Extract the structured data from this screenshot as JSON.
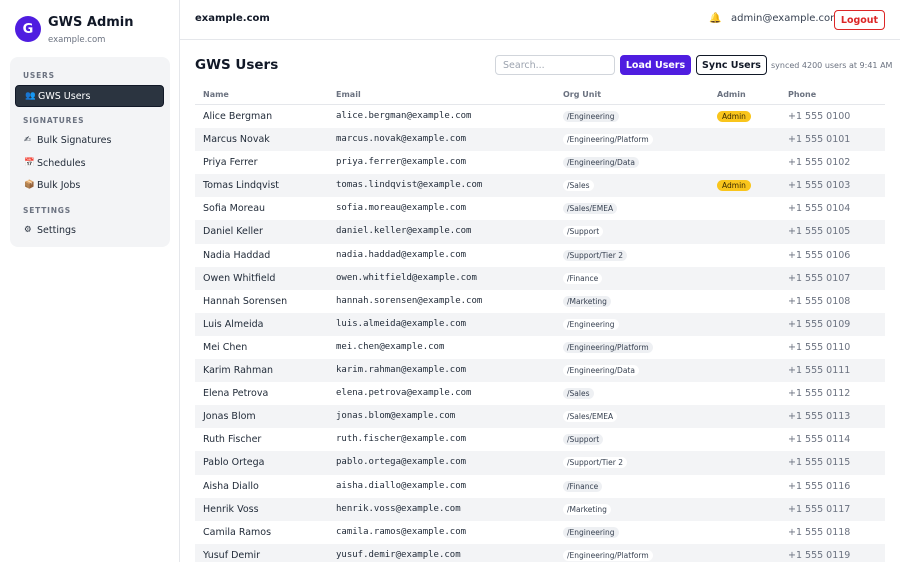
{
  "brand": {
    "logo_letter": "G",
    "title": "GWS Admin",
    "subtitle": "example.com"
  },
  "sidebar": {
    "sections": [
      {
        "label": "USERS"
      },
      {
        "label": "SIGNATURES"
      },
      {
        "label": "SETTINGS"
      }
    ],
    "items": [
      {
        "label": "GWS Users",
        "icon": "users-icon",
        "glyph": "👥",
        "active": true
      },
      {
        "label": "Bulk Signatures",
        "icon": "pen-icon",
        "glyph": "✍"
      },
      {
        "label": "Schedules",
        "icon": "calendar-icon",
        "glyph": "📅"
      },
      {
        "label": "Bulk Jobs",
        "icon": "box-icon",
        "glyph": "📦"
      },
      {
        "label": "Settings",
        "icon": "gear-icon",
        "glyph": "⚙"
      }
    ]
  },
  "topbar": {
    "domain": "example.com",
    "notification_glyph": "🔔",
    "user_email": "admin@example.com",
    "logout_label": "Logout"
  },
  "main": {
    "title": "GWS Users",
    "search_placeholder": "Search...",
    "load_label": "Load Users",
    "sync_label": "Sync Users",
    "sync_status": "synced 4200 users at 9:41 AM"
  },
  "table": {
    "headers": {
      "name": "Name",
      "email": "Email",
      "org": "Org Unit",
      "admin": "Admin",
      "phone": "Phone"
    },
    "rows": [
      {
        "name": "Alice Bergman",
        "email": "alice.bergman@example.com",
        "org": "/Engineering",
        "admin": "Admin",
        "phone": "+1 555 0100"
      },
      {
        "name": "Marcus Novak",
        "email": "marcus.novak@example.com",
        "org": "/Engineering/Platform",
        "admin": "",
        "phone": "+1 555 0101"
      },
      {
        "name": "Priya Ferrer",
        "email": "priya.ferrer@example.com",
        "org": "/Engineering/Data",
        "admin": "",
        "phone": "+1 555 0102"
      },
      {
        "name": "Tomas Lindqvist",
        "email": "tomas.lindqvist@example.com",
        "org": "/Sales",
        "admin": "Admin",
        "phone": "+1 555 0103"
      },
      {
        "name": "Sofia Moreau",
        "email": "sofia.moreau@example.com",
        "org": "/Sales/EMEA",
        "admin": "",
        "phone": "+1 555 0104"
      },
      {
        "name": "Daniel Keller",
        "email": "daniel.keller@example.com",
        "org": "/Support",
        "admin": "",
        "phone": "+1 555 0105"
      },
      {
        "name": "Nadia Haddad",
        "email": "nadia.haddad@example.com",
        "org": "/Support/Tier 2",
        "admin": "",
        "phone": "+1 555 0106"
      },
      {
        "name": "Owen Whitfield",
        "email": "owen.whitfield@example.com",
        "org": "/Finance",
        "admin": "",
        "phone": "+1 555 0107"
      },
      {
        "name": "Hannah Sorensen",
        "email": "hannah.sorensen@example.com",
        "org": "/Marketing",
        "admin": "",
        "phone": "+1 555 0108"
      },
      {
        "name": "Luis Almeida",
        "email": "luis.almeida@example.com",
        "org": "/Engineering",
        "admin": "",
        "phone": "+1 555 0109"
      },
      {
        "name": "Mei Chen",
        "email": "mei.chen@example.com",
        "org": "/Engineering/Platform",
        "admin": "",
        "phone": "+1 555 0110"
      },
      {
        "name": "Karim Rahman",
        "email": "karim.rahman@example.com",
        "org": "/Engineering/Data",
        "admin": "",
        "phone": "+1 555 0111"
      },
      {
        "name": "Elena Petrova",
        "email": "elena.petrova@example.com",
        "org": "/Sales",
        "admin": "",
        "phone": "+1 555 0112"
      },
      {
        "name": "Jonas Blom",
        "email": "jonas.blom@example.com",
        "org": "/Sales/EMEA",
        "admin": "",
        "phone": "+1 555 0113"
      },
      {
        "name": "Ruth Fischer",
        "email": "ruth.fischer@example.com",
        "org": "/Support",
        "admin": "",
        "phone": "+1 555 0114"
      },
      {
        "name": "Pablo Ortega",
        "email": "pablo.ortega@example.com",
        "org": "/Support/Tier 2",
        "admin": "",
        "phone": "+1 555 0115"
      },
      {
        "name": "Aisha Diallo",
        "email": "aisha.diallo@example.com",
        "org": "/Finance",
        "admin": "",
        "phone": "+1 555 0116"
      },
      {
        "name": "Henrik Voss",
        "email": "henrik.voss@example.com",
        "org": "/Marketing",
        "admin": "",
        "phone": "+1 555 0117"
      },
      {
        "name": "Camila Ramos",
        "email": "camila.ramos@example.com",
        "org": "/Engineering",
        "admin": "",
        "phone": "+1 555 0118"
      },
      {
        "name": "Yusuf Demir",
        "email": "yusuf.demir@example.com",
        "org": "/Engineering/Platform",
        "admin": "",
        "phone": "+1 555 0119"
      }
    ]
  },
  "colors": {
    "accent": "#4f1de0",
    "danger": "#dc2626",
    "admin_badge": "#f9c51c",
    "active_nav": "#2b3440"
  }
}
